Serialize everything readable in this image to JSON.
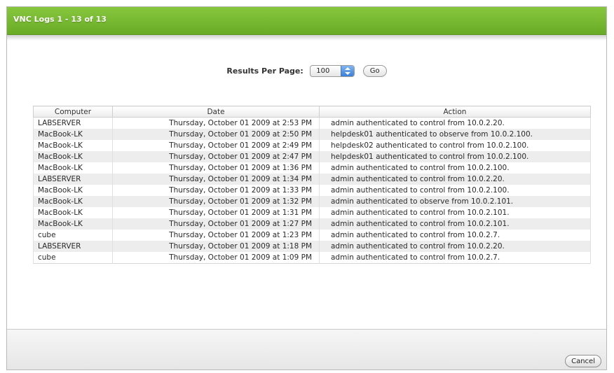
{
  "window": {
    "title": "VNC Logs 1 - 13 of 13"
  },
  "controls": {
    "results_label": "Results Per Page:",
    "results_value": "100",
    "go_label": "Go"
  },
  "table": {
    "headers": [
      "Computer",
      "Date",
      "Action"
    ],
    "rows": [
      [
        "LABSERVER",
        "Thursday, October 01 2009 at 2:53 PM",
        "admin authenticated to control from 10.0.2.20."
      ],
      [
        "MacBook-LK",
        "Thursday, October 01 2009 at 2:50 PM",
        "helpdesk01 authenticated to observe from 10.0.2.100."
      ],
      [
        "MacBook-LK",
        "Thursday, October 01 2009 at 2:49 PM",
        "helpdesk02 authenticated to control from 10.0.2.100."
      ],
      [
        "MacBook-LK",
        "Thursday, October 01 2009 at 2:47 PM",
        "helpdesk01 authenticated to control from 10.0.2.100."
      ],
      [
        "MacBook-LK",
        "Thursday, October 01 2009 at 1:36 PM",
        "admin authenticated to control from 10.0.2.100."
      ],
      [
        "LABSERVER",
        "Thursday, October 01 2009 at 1:34 PM",
        "admin authenticated to control from 10.0.2.20."
      ],
      [
        "MacBook-LK",
        "Thursday, October 01 2009 at 1:33 PM",
        "admin authenticated to control from 10.0.2.100."
      ],
      [
        "MacBook-LK",
        "Thursday, October 01 2009 at 1:32 PM",
        "admin authenticated to observe from 10.0.2.101."
      ],
      [
        "MacBook-LK",
        "Thursday, October 01 2009 at 1:31 PM",
        "admin authenticated to control from 10.0.2.101."
      ],
      [
        "MacBook-LK",
        "Thursday, October 01 2009 at 1:27 PM",
        "admin authenticated to control from 10.0.2.101."
      ],
      [
        "cube",
        "Thursday, October 01 2009 at 1:23 PM",
        "admin authenticated to control from 10.0.2.7."
      ],
      [
        "LABSERVER",
        "Thursday, October 01 2009 at 1:18 PM",
        "admin authenticated to control from 10.0.2.20."
      ],
      [
        "cube",
        "Thursday, October 01 2009 at 1:09 PM",
        "admin authenticated to control from 10.0.2.7."
      ]
    ]
  },
  "footer": {
    "cancel_label": "Cancel"
  },
  "colors": {
    "titlebar": "#78b832",
    "row_alt": "#ededed"
  }
}
